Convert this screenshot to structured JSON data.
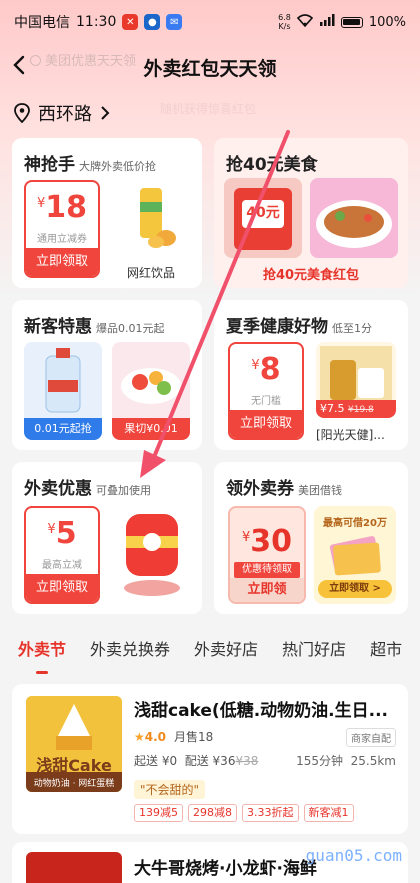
{
  "status_bar": {
    "carrier": "中国电信",
    "time": "11:30",
    "net_speed_top": "6.8",
    "net_speed_unit": "K/s",
    "battery": "100%"
  },
  "header": {
    "title": "外卖红包天天领",
    "search_placeholder": "美团优惠天天领",
    "ghost_subtitle": "随机获得惊喜红包"
  },
  "location": {
    "name": "西环路"
  },
  "cards": {
    "shenqiang": {
      "title": "神抢手",
      "subtitle": "大牌外卖低价抢",
      "coupon": {
        "yen": "¥",
        "amount": "18",
        "desc": "通用立减券",
        "button": "立即领取"
      },
      "product_label": "网红饮品"
    },
    "meishi": {
      "title": "抢40元美食",
      "badge_amount": "40元",
      "banner": "抢40元美食红包"
    },
    "xinke": {
      "title": "新客特惠",
      "subtitle": "爆品0.01元起",
      "item1_tag": "0.01元起抢",
      "item2_tag": "果切¥0.01"
    },
    "jiankang": {
      "title": "夏季健康好物",
      "subtitle": "低至1分",
      "coupon": {
        "yen": "¥",
        "amount": "8",
        "desc": "无门槛",
        "button": "立即领取"
      },
      "price": "¥7.5",
      "old_price": "¥19.8",
      "product_label": "[阳光天健]..."
    },
    "waimai": {
      "title": "外卖优惠",
      "subtitle": "可叠加使用",
      "coupon": {
        "yen": "¥",
        "amount": "5",
        "desc": "最高立减",
        "button": "立即领取"
      }
    },
    "lingwaimai": {
      "title": "领外卖券",
      "subtitle": "美团借钱",
      "coupon": {
        "yen": "¥",
        "amount": "30",
        "desc": "优惠待领取",
        "button": "立即领"
      },
      "promo_text": "最高可借20万",
      "promo_button": "立即领取 >"
    }
  },
  "tabs": [
    "外卖节",
    "外卖兑换券",
    "外卖好店",
    "热门好店",
    "超市"
  ],
  "stores": [
    {
      "name": "浅甜cake(低糖.动物奶油.生日...",
      "logo_text": "浅甜Cake",
      "logo_sub": "动物奶油 · 网红蛋糕",
      "rating": "4.0",
      "monthly": "月售18",
      "biz_tag": "商家自配",
      "start_fee": "起送 ¥0",
      "delivery_label": "配送 ¥36",
      "delivery_old": "¥38",
      "time": "155分钟",
      "distance": "25.5km",
      "quote": "\"不会甜的\"",
      "promos": [
        "139减5",
        "298减8",
        "3.33折起",
        "新客减1"
      ]
    },
    {
      "name": "大牛哥烧烤·小龙虾·海鲜"
    }
  ],
  "watermark": "guan05.com",
  "colors": {
    "accent": "#f0453c",
    "tab_active": "#e7342b",
    "link_blue": "#2f7bea"
  }
}
